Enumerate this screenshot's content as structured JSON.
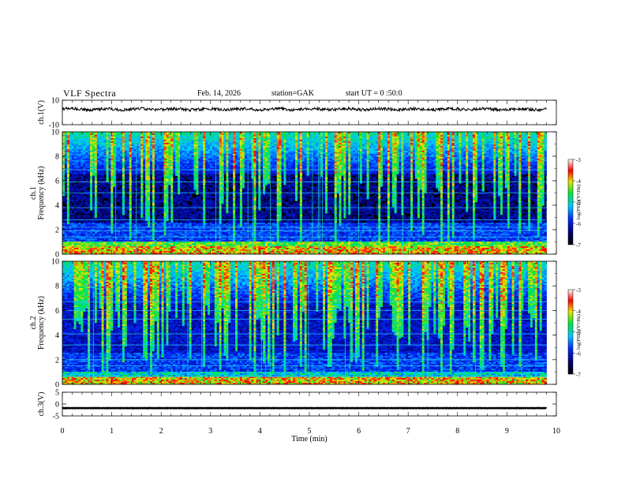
{
  "header": {
    "title": "VLF Spectra",
    "date": "Feb. 14, 2026",
    "station": "station=GAK",
    "start": "start UT = 0 :50:0"
  },
  "chart_data": [
    {
      "type": "line",
      "panel": "ch1-waveform",
      "ylabel": "ch.1(V)",
      "ylim": [
        -10,
        10
      ],
      "yticks": [
        "10",
        "-10"
      ],
      "xlim": [
        0,
        10
      ],
      "x_end": 9.8,
      "baseline": 2.6,
      "amplitude": 1.2,
      "color": "#000000"
    },
    {
      "type": "heatmap",
      "panel": "ch1-spectrogram",
      "ylabel": [
        "ch.1",
        "Frequency (kHz)"
      ],
      "ylim": [
        0,
        10
      ],
      "yticks": [
        "0",
        "2",
        "4",
        "6",
        "8",
        "10"
      ],
      "xlim": [
        0,
        10
      ],
      "x_end": 9.8,
      "colorbar": {
        "label": "log(PSD)(V²/Hz)",
        "range": [
          -7,
          -3
        ],
        "ticks": [
          "-3",
          "-4",
          "-5",
          "-6",
          "-7"
        ]
      }
    },
    {
      "type": "heatmap",
      "panel": "ch2-spectrogram",
      "ylabel": [
        "ch.2",
        "Frequency (kHz)"
      ],
      "ylim": [
        0,
        10
      ],
      "yticks": [
        "0",
        "2",
        "4",
        "6",
        "8",
        "10"
      ],
      "xlim": [
        0,
        10
      ],
      "x_end": 9.8,
      "colorbar": {
        "label": "log(PSD)(V²/Hz)",
        "range": [
          -7,
          -3
        ],
        "ticks": [
          "-3",
          "-4",
          "-5",
          "-6",
          "-7"
        ]
      }
    },
    {
      "type": "line",
      "panel": "ch3-waveform",
      "ylabel": "ch.3(V)",
      "ylim": [
        -5,
        5
      ],
      "yticks": [
        "5",
        "0",
        "-5"
      ],
      "xlim": [
        0,
        10
      ],
      "x_end": 9.8,
      "baseline": -1.7,
      "amplitude": 0.1,
      "color": "#000000"
    }
  ],
  "xaxis": {
    "label": "Time (min)",
    "ticks": [
      "0",
      "1",
      "2",
      "3",
      "4",
      "5",
      "6",
      "7",
      "8",
      "9",
      "10"
    ]
  }
}
